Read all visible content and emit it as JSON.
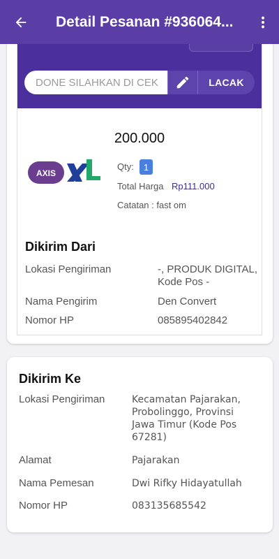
{
  "appbar": {
    "title": "Detail Pesanan #936064...",
    "icons": {
      "back": "arrow-back-icon",
      "more": "more-vert-icon"
    }
  },
  "tracking": {
    "resi_placeholder": "DONE SILAHKAN DI CEK",
    "edit_icon": "pencil-icon",
    "track_label": "LACAK"
  },
  "product": {
    "price": "200.000",
    "logo": "axis-xl-logo",
    "qty_label": "Qty:",
    "qty": "1",
    "total_label": "Total Harga",
    "total_value": "Rp111.000",
    "notes": "Catatan : fast om"
  },
  "sender": {
    "title": "Dikirim Dari",
    "rows": [
      {
        "label": "Lokasi Pengiriman",
        "value": "-, PRODUK DIGITAL,\nKode Pos -"
      },
      {
        "label": "Nama Pengirim",
        "value": "Den Convert"
      },
      {
        "label": "Nomor HP",
        "value": "085895402842"
      }
    ]
  },
  "recipient": {
    "title": "Dikirim Ke",
    "rows": [
      {
        "label": "Lokasi Pengiriman",
        "value": "Kecamatan Pajarakan,\nProbolinggo, Provinsi\nJawa Timur (Kode Pos\n67281)"
      },
      {
        "label": "Alamat",
        "value": "Pajarakan"
      },
      {
        "label": "Nama Pemesan",
        "value": "Dwi Rifky Hidayatullah"
      },
      {
        "label": "Nomor HP",
        "value": "083135685542"
      }
    ]
  },
  "colors": {
    "appbar": "#5a3ea6",
    "band": "#4b2f9c",
    "button": "#5d44ad",
    "qty_badge": "#4a7fe0"
  }
}
